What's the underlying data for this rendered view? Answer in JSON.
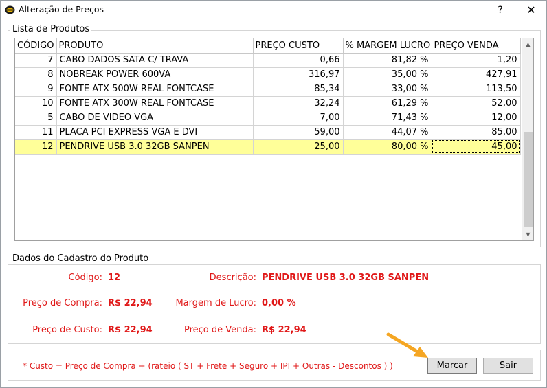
{
  "window": {
    "title": "Alteração de Preços",
    "help_label": "?",
    "close_label": "✕"
  },
  "product_list": {
    "group_label": "Lista de Produtos",
    "columns": [
      "CÓDIGO",
      "PRODUTO",
      "PREÇO CUSTO",
      "% MARGEM LUCRO",
      "PREÇO VENDA"
    ],
    "rows": [
      {
        "codigo": "7",
        "produto": "CABO DADOS SATA C/ TRAVA",
        "preco_custo": "0,66",
        "margem": "81,82 %",
        "preco_venda": "1,20",
        "selected": false
      },
      {
        "codigo": "8",
        "produto": "NOBREAK POWER 600VA",
        "preco_custo": "316,97",
        "margem": "35,00 %",
        "preco_venda": "427,91",
        "selected": false
      },
      {
        "codigo": "9",
        "produto": "FONTE ATX 500W REAL FONTCASE",
        "preco_custo": "85,34",
        "margem": "33,00 %",
        "preco_venda": "113,50",
        "selected": false
      },
      {
        "codigo": "10",
        "produto": "FONTE ATX 300W REAL FONTCASE",
        "preco_custo": "32,24",
        "margem": "61,29 %",
        "preco_venda": "52,00",
        "selected": false
      },
      {
        "codigo": "5",
        "produto": "CABO DE VIDEO VGA",
        "preco_custo": "7,00",
        "margem": "71,43 %",
        "preco_venda": "12,00",
        "selected": false
      },
      {
        "codigo": "11",
        "produto": "PLACA PCI EXPRESS VGA E DVI",
        "preco_custo": "59,00",
        "margem": "44,07 %",
        "preco_venda": "85,00",
        "selected": false
      },
      {
        "codigo": "12",
        "produto": "PENDRIVE USB 3.0 32GB SANPEN",
        "preco_custo": "25,00",
        "margem": "80,00 %",
        "preco_venda": "45,00",
        "selected": true
      }
    ],
    "scroll_up_icon": "▲",
    "scroll_down_icon": "▼"
  },
  "details": {
    "group_label": "Dados do Cadastro do Produto",
    "codigo_label": "Código:",
    "codigo_value": "12",
    "descricao_label": "Descrição:",
    "descricao_value": "PENDRIVE USB 3.0 32GB SANPEN",
    "preco_compra_label": "Preço de Compra:",
    "preco_compra_value": "R$ 22,94",
    "margem_label": "Margem de Lucro:",
    "margem_value": "0,00 %",
    "preco_custo_label": "Preço de Custo:",
    "preco_custo_value": "R$ 22,94",
    "preco_venda_label": "Preço de Venda:",
    "preco_venda_value": "R$ 22,94"
  },
  "footer": {
    "note": "* Custo =  Preço de Compra + (rateio ( ST + Frete + Seguro + IPI +  Outras - Descontos ) )",
    "marcar_label": "Marcar",
    "sair_label": "Sair"
  },
  "colors": {
    "accent_red": "#e01818",
    "selected_row": "#ffff99",
    "pointer_arrow": "#f5a623"
  }
}
